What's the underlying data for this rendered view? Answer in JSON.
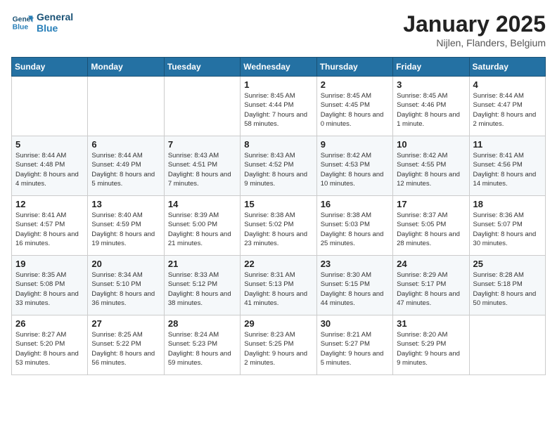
{
  "header": {
    "logo_line1": "General",
    "logo_line2": "Blue",
    "title": "January 2025",
    "subtitle": "Nijlen, Flanders, Belgium"
  },
  "weekdays": [
    "Sunday",
    "Monday",
    "Tuesday",
    "Wednesday",
    "Thursday",
    "Friday",
    "Saturday"
  ],
  "weeks": [
    [
      {
        "day": "",
        "info": ""
      },
      {
        "day": "",
        "info": ""
      },
      {
        "day": "",
        "info": ""
      },
      {
        "day": "1",
        "info": "Sunrise: 8:45 AM\nSunset: 4:44 PM\nDaylight: 7 hours and 58 minutes."
      },
      {
        "day": "2",
        "info": "Sunrise: 8:45 AM\nSunset: 4:45 PM\nDaylight: 8 hours and 0 minutes."
      },
      {
        "day": "3",
        "info": "Sunrise: 8:45 AM\nSunset: 4:46 PM\nDaylight: 8 hours and 1 minute."
      },
      {
        "day": "4",
        "info": "Sunrise: 8:44 AM\nSunset: 4:47 PM\nDaylight: 8 hours and 2 minutes."
      }
    ],
    [
      {
        "day": "5",
        "info": "Sunrise: 8:44 AM\nSunset: 4:48 PM\nDaylight: 8 hours and 4 minutes."
      },
      {
        "day": "6",
        "info": "Sunrise: 8:44 AM\nSunset: 4:49 PM\nDaylight: 8 hours and 5 minutes."
      },
      {
        "day": "7",
        "info": "Sunrise: 8:43 AM\nSunset: 4:51 PM\nDaylight: 8 hours and 7 minutes."
      },
      {
        "day": "8",
        "info": "Sunrise: 8:43 AM\nSunset: 4:52 PM\nDaylight: 8 hours and 9 minutes."
      },
      {
        "day": "9",
        "info": "Sunrise: 8:42 AM\nSunset: 4:53 PM\nDaylight: 8 hours and 10 minutes."
      },
      {
        "day": "10",
        "info": "Sunrise: 8:42 AM\nSunset: 4:55 PM\nDaylight: 8 hours and 12 minutes."
      },
      {
        "day": "11",
        "info": "Sunrise: 8:41 AM\nSunset: 4:56 PM\nDaylight: 8 hours and 14 minutes."
      }
    ],
    [
      {
        "day": "12",
        "info": "Sunrise: 8:41 AM\nSunset: 4:57 PM\nDaylight: 8 hours and 16 minutes."
      },
      {
        "day": "13",
        "info": "Sunrise: 8:40 AM\nSunset: 4:59 PM\nDaylight: 8 hours and 19 minutes."
      },
      {
        "day": "14",
        "info": "Sunrise: 8:39 AM\nSunset: 5:00 PM\nDaylight: 8 hours and 21 minutes."
      },
      {
        "day": "15",
        "info": "Sunrise: 8:38 AM\nSunset: 5:02 PM\nDaylight: 8 hours and 23 minutes."
      },
      {
        "day": "16",
        "info": "Sunrise: 8:38 AM\nSunset: 5:03 PM\nDaylight: 8 hours and 25 minutes."
      },
      {
        "day": "17",
        "info": "Sunrise: 8:37 AM\nSunset: 5:05 PM\nDaylight: 8 hours and 28 minutes."
      },
      {
        "day": "18",
        "info": "Sunrise: 8:36 AM\nSunset: 5:07 PM\nDaylight: 8 hours and 30 minutes."
      }
    ],
    [
      {
        "day": "19",
        "info": "Sunrise: 8:35 AM\nSunset: 5:08 PM\nDaylight: 8 hours and 33 minutes."
      },
      {
        "day": "20",
        "info": "Sunrise: 8:34 AM\nSunset: 5:10 PM\nDaylight: 8 hours and 36 minutes."
      },
      {
        "day": "21",
        "info": "Sunrise: 8:33 AM\nSunset: 5:12 PM\nDaylight: 8 hours and 38 minutes."
      },
      {
        "day": "22",
        "info": "Sunrise: 8:31 AM\nSunset: 5:13 PM\nDaylight: 8 hours and 41 minutes."
      },
      {
        "day": "23",
        "info": "Sunrise: 8:30 AM\nSunset: 5:15 PM\nDaylight: 8 hours and 44 minutes."
      },
      {
        "day": "24",
        "info": "Sunrise: 8:29 AM\nSunset: 5:17 PM\nDaylight: 8 hours and 47 minutes."
      },
      {
        "day": "25",
        "info": "Sunrise: 8:28 AM\nSunset: 5:18 PM\nDaylight: 8 hours and 50 minutes."
      }
    ],
    [
      {
        "day": "26",
        "info": "Sunrise: 8:27 AM\nSunset: 5:20 PM\nDaylight: 8 hours and 53 minutes."
      },
      {
        "day": "27",
        "info": "Sunrise: 8:25 AM\nSunset: 5:22 PM\nDaylight: 8 hours and 56 minutes."
      },
      {
        "day": "28",
        "info": "Sunrise: 8:24 AM\nSunset: 5:23 PM\nDaylight: 8 hours and 59 minutes."
      },
      {
        "day": "29",
        "info": "Sunrise: 8:23 AM\nSunset: 5:25 PM\nDaylight: 9 hours and 2 minutes."
      },
      {
        "day": "30",
        "info": "Sunrise: 8:21 AM\nSunset: 5:27 PM\nDaylight: 9 hours and 5 minutes."
      },
      {
        "day": "31",
        "info": "Sunrise: 8:20 AM\nSunset: 5:29 PM\nDaylight: 9 hours and 9 minutes."
      },
      {
        "day": "",
        "info": ""
      }
    ]
  ]
}
